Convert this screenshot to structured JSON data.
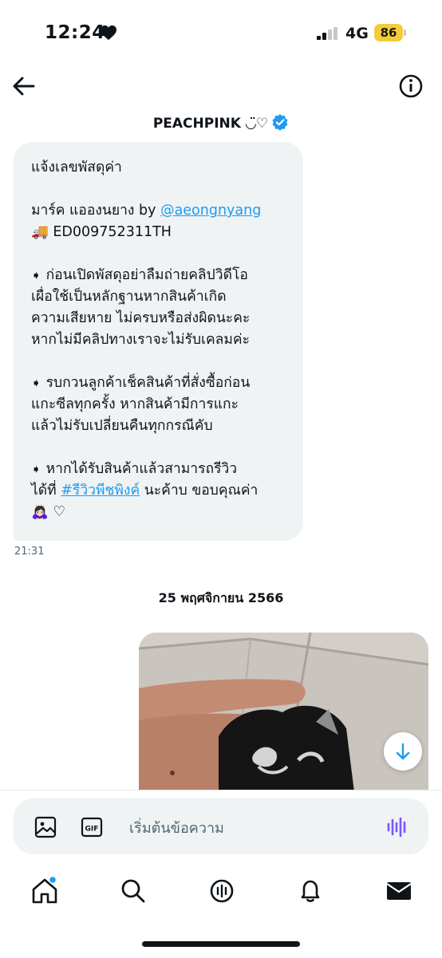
{
  "status_bar": {
    "time": "12:24",
    "network": "4G",
    "battery": "86"
  },
  "header": {
    "name": "PEACHPINK ◡̈♡"
  },
  "message": {
    "line1": "แจ้งเลขพัสดุค่า",
    "line2_prefix": "มาร์ค แอองนยาง by ",
    "line2_link": "@aeongnyang",
    "line3": "🚚 ED009752311TH",
    "b1_1": "ก่อนเปิดพัสดุอย่าลืมถ่ายคลิปวิดีโอ",
    "b1_2": "เผื่อใช้เป็นหลักฐานหากสินค้าเกิด",
    "b1_3": "ความเสียหาย ไม่ครบหรือส่งผิดนะคะ",
    "b1_4": "หากไม่มีคลิปทางเราจะไม่รับเคลมค่ะ",
    "b2_1": "รบกวนลูกค้าเช็คสินค้าที่สั่งซื้อก่อน",
    "b2_2": "แกะซีลทุกครั้ง หากสินค้ามีการแกะ",
    "b2_3": "แล้วไม่รับเปลี่ยนคืนทุกกรณีคับ",
    "b3_1": "หากได้รับสินค้าแล้วสามารถรีวิว",
    "b3_2_prefix": "ได้ที่ ",
    "b3_2_link": "#รีวิวพีชพิงค์",
    "b3_2_suffix": " นะค้าบ ขอบคุณค่า",
    "b3_3": "🙇🏻‍♀️ ♡",
    "time": "21:31"
  },
  "date_separator": "25 พฤศจิกายน 2566",
  "composer": {
    "placeholder": "เริ่มต้นข้อความ",
    "gif_label": "GIF"
  },
  "colors": {
    "accent": "#1d9bf0",
    "bubble": "#eff3f4",
    "battery": "#f4cc3a"
  },
  "icons": [
    "heart-icon",
    "signal-icon",
    "back-arrow-icon",
    "info-icon",
    "verified-badge-icon",
    "arrow-down-icon",
    "image-icon",
    "gif-icon",
    "voice-icon",
    "home-icon",
    "search-icon",
    "spaces-icon",
    "bell-icon",
    "mail-icon"
  ]
}
